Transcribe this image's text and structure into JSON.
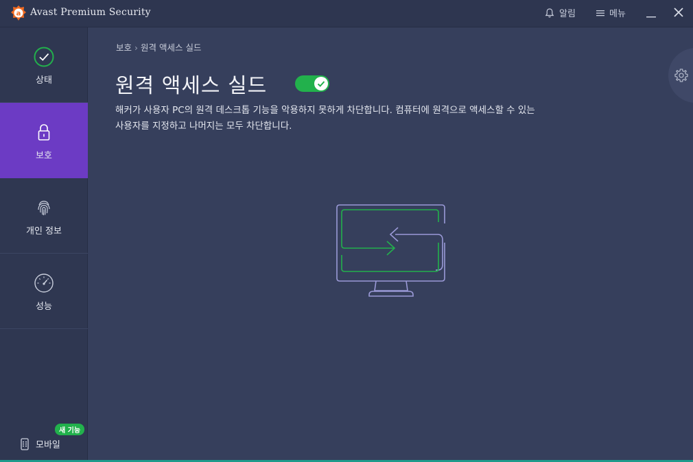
{
  "window": {
    "title": "Avast Premium Security",
    "notifications_label": "알림",
    "menu_label": "메뉴"
  },
  "sidebar": {
    "items": [
      {
        "label": "상태",
        "icon": "check-circle-icon",
        "active": false
      },
      {
        "label": "보호",
        "icon": "lock-icon",
        "active": true
      },
      {
        "label": "개인 정보",
        "icon": "fingerprint-icon",
        "active": false
      },
      {
        "label": "성능",
        "icon": "speedometer-icon",
        "active": false
      }
    ],
    "mobile_label": "모바일",
    "new_badge": "새 기능"
  },
  "main": {
    "breadcrumb": [
      "보호",
      "원격 액세스 실드"
    ],
    "breadcrumb_separator": "›",
    "title": "원격 액세스 실드",
    "toggle_on": true,
    "description": "해커가 사용자 PC의 원격 데스크톱 기능을 악용하지 못하게 차단합니다. 컴퓨터에 원격으로 액세스할 수 있는 사용자를 지정하고 나머지는 모두 차단합니다."
  },
  "colors": {
    "background": "#363f5c",
    "sidebar": "#2f3751",
    "active": "#6c3bc4",
    "accent_green": "#22b14c",
    "brand_orange": "#f26b21",
    "illustration_stroke": "#9b9ad8"
  }
}
